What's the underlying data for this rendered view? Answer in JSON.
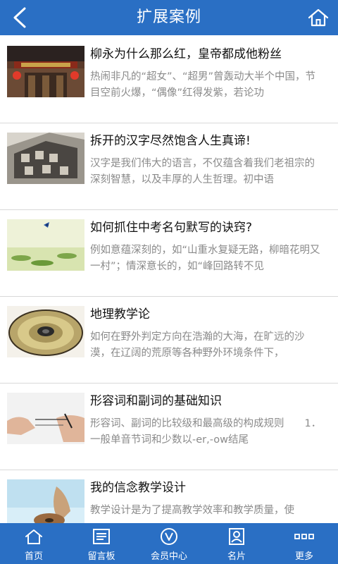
{
  "header": {
    "title": "扩展案例"
  },
  "articles": [
    {
      "title": "柳永为什么那么红，皇帝都成他粉丝",
      "desc": "热闹非凡的“超女”、“超男”曾轰动大半个中国，节目空前火爆，“偶像”红得发紫，若论功"
    },
    {
      "title": "拆开的汉字尽然饱含人生真谛!",
      "desc": "汉字是我们伟大的语言，不仅蕴含着我们老祖宗的深刻智慧，以及丰厚的人生哲理。初中语"
    },
    {
      "title": "如何抓住中考名句默写的诀窍?",
      "desc": "例如意蕴深刻的，如“山重水复疑无路，柳暗花明又一村”；情深意长的，如“峰回路转不见"
    },
    {
      "title": "地理教学论",
      "desc": "如何在野外判定方向在浩瀚的大海，在旷远的沙漠，在辽阔的荒原等各种野外环境条件下，"
    },
    {
      "title": "形容词和副词的基础知识",
      "desc": "形容词、副词的比较级和最高级的构成规则　　1．一般单音节词和少数以-er,-ow结尾"
    },
    {
      "title": "我的信念教学设计",
      "desc": "教学设计是为了提高教学效率和教学质量，使"
    }
  ],
  "tabbar": {
    "items": [
      {
        "label": "首页",
        "icon": "home-icon"
      },
      {
        "label": "留言板",
        "icon": "message-board-icon"
      },
      {
        "label": "会员中心",
        "icon": "member-icon"
      },
      {
        "label": "名片",
        "icon": "business-card-icon"
      },
      {
        "label": "更多",
        "icon": "more-icon"
      }
    ]
  },
  "colors": {
    "brand": "#2a6fc4",
    "title_text": "#111111",
    "desc_text": "#8a8a8a"
  }
}
